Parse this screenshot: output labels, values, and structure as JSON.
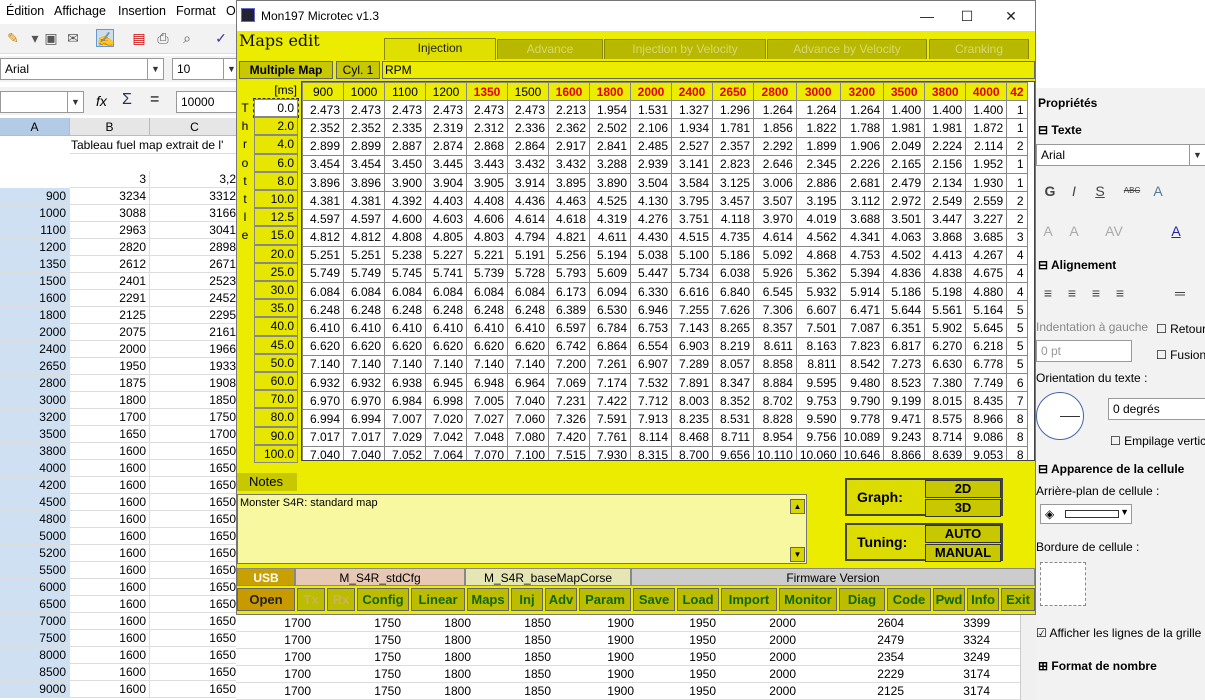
{
  "menubar": {
    "items": [
      "Édition",
      "Affichage",
      "Insertion",
      "Format",
      "O"
    ]
  },
  "font": {
    "name": "Arial",
    "size": "10"
  },
  "formula": {
    "value": "10000"
  },
  "sheet": {
    "columns": [
      "A",
      "B",
      "C"
    ],
    "row1": {
      "b": "Tableau fuel map extrait de l'"
    },
    "row3": {
      "b": "3",
      "c": "3,2"
    },
    "rows": [
      [
        "900",
        "3234",
        "3312"
      ],
      [
        "1000",
        "3088",
        "3166"
      ],
      [
        "1100",
        "2963",
        "3041"
      ],
      [
        "1200",
        "2820",
        "2898"
      ],
      [
        "1350",
        "2612",
        "2671"
      ],
      [
        "1500",
        "2401",
        "2523"
      ],
      [
        "1600",
        "2291",
        "2452"
      ],
      [
        "1800",
        "2125",
        "2295"
      ],
      [
        "2000",
        "2075",
        "2161"
      ],
      [
        "2400",
        "2000",
        "1966"
      ],
      [
        "2650",
        "1950",
        "1933"
      ],
      [
        "2800",
        "1875",
        "1908"
      ],
      [
        "3000",
        "1800",
        "1850"
      ],
      [
        "3200",
        "1700",
        "1750"
      ],
      [
        "3500",
        "1650",
        "1700"
      ],
      [
        "3800",
        "1600",
        "1650"
      ],
      [
        "4000",
        "1600",
        "1650"
      ],
      [
        "4200",
        "1600",
        "1650"
      ],
      [
        "4500",
        "1600",
        "1650"
      ],
      [
        "4800",
        "1600",
        "1650"
      ],
      [
        "5000",
        "1600",
        "1650"
      ],
      [
        "5200",
        "1600",
        "1650"
      ],
      [
        "5500",
        "1600",
        "1650"
      ],
      [
        "6000",
        "1600",
        "1650"
      ],
      [
        "6500",
        "1600",
        "1650"
      ],
      [
        "7000",
        "1600",
        "1650"
      ],
      [
        "7500",
        "1600",
        "1650"
      ],
      [
        "8000",
        "1600",
        "1650"
      ],
      [
        "8500",
        "1600",
        "1650"
      ],
      [
        "9000",
        "1600",
        "1650"
      ]
    ],
    "bottom_extra": [
      [
        "1700",
        "1750",
        "1800",
        "1850",
        "1900",
        "1950",
        "2000",
        "2604",
        "3399"
      ],
      [
        "1700",
        "1750",
        "1800",
        "1850",
        "1900",
        "1950",
        "2000",
        "2479",
        "3324"
      ],
      [
        "1700",
        "1750",
        "1800",
        "1850",
        "1900",
        "1950",
        "2000",
        "2354",
        "3249"
      ],
      [
        "1700",
        "1750",
        "1800",
        "1850",
        "1900",
        "1950",
        "2000",
        "2229",
        "3174"
      ],
      [
        "1700",
        "1750",
        "1800",
        "1850",
        "1900",
        "1950",
        "2000",
        "2125",
        "3174"
      ]
    ]
  },
  "props": {
    "title": "Propriétés",
    "texte": "Texte",
    "font": "Arial",
    "alignement": "Alignement",
    "indent": "Indentation à gauche",
    "indent_val": "0 pt",
    "retour": "Retour",
    "fusion": "Fusion",
    "orientation": "Orientation du texte :",
    "degrees": "0 degrés",
    "empilage": "Empilage vertic",
    "apparence": "Apparence de la cellule",
    "arriere": "Arrière-plan de cellule :",
    "bordure": "Bordure de cellule :",
    "grid_lines": "Afficher les lignes de la grille",
    "format": "Format de nombre"
  },
  "app": {
    "title": "Mon197 Microtec v1.3",
    "maps_edit": "Maps edit",
    "tabs": [
      "Injection",
      "Advance",
      "Injection by Velocity",
      "Advance by Velocity",
      "Cranking"
    ],
    "multiple_map": "Multiple Map",
    "cyl": "Cyl. 1",
    "rpm": "RPM",
    "ms": "[ms]",
    "throttle": [
      "T",
      "h",
      "r",
      "o",
      "t",
      "t",
      "l",
      "e"
    ],
    "rpm_cols": [
      "900",
      "1000",
      "1100",
      "1200",
      "1350",
      "1500",
      "1600",
      "1800",
      "2000",
      "2400",
      "2650",
      "2800",
      "3000",
      "3200",
      "3500",
      "3800",
      "4000",
      "42"
    ],
    "red_cols": [
      4,
      6,
      7,
      8,
      9,
      10,
      11,
      12,
      13,
      14,
      15,
      16,
      17
    ],
    "throttle_rows": [
      "0.0",
      "2.0",
      "4.0",
      "6.0",
      "8.0",
      "10.0",
      "12.5",
      "15.0",
      "20.0",
      "25.0",
      "30.0",
      "35.0",
      "40.0",
      "45.0",
      "50.0",
      "60.0",
      "70.0",
      "80.0",
      "90.0",
      "100.0"
    ],
    "table": [
      [
        "2.473",
        "2.473",
        "2.473",
        "2.473",
        "2.473",
        "2.473",
        "2.213",
        "1.954",
        "1.531",
        "1.327",
        "1.296",
        "1.264",
        "1.264",
        "1.264",
        "1.400",
        "1.400",
        "1.400",
        "1"
      ],
      [
        "2.352",
        "2.352",
        "2.335",
        "2.319",
        "2.312",
        "2.336",
        "2.362",
        "2.502",
        "2.106",
        "1.934",
        "1.781",
        "1.856",
        "1.822",
        "1.788",
        "1.981",
        "1.981",
        "1.872",
        "1"
      ],
      [
        "2.899",
        "2.899",
        "2.887",
        "2.874",
        "2.868",
        "2.864",
        "2.917",
        "2.841",
        "2.485",
        "2.527",
        "2.357",
        "2.292",
        "1.899",
        "1.906",
        "2.049",
        "2.224",
        "2.114",
        "2"
      ],
      [
        "3.454",
        "3.454",
        "3.450",
        "3.445",
        "3.443",
        "3.432",
        "3.432",
        "3.288",
        "2.939",
        "3.141",
        "2.823",
        "2.646",
        "2.345",
        "2.226",
        "2.165",
        "2.156",
        "1.952",
        "1"
      ],
      [
        "3.896",
        "3.896",
        "3.900",
        "3.904",
        "3.905",
        "3.914",
        "3.895",
        "3.890",
        "3.504",
        "3.584",
        "3.125",
        "3.006",
        "2.886",
        "2.681",
        "2.479",
        "2.134",
        "1.930",
        "1"
      ],
      [
        "4.381",
        "4.381",
        "4.392",
        "4.403",
        "4.408",
        "4.436",
        "4.463",
        "4.525",
        "4.130",
        "3.795",
        "3.457",
        "3.507",
        "3.195",
        "3.112",
        "2.972",
        "2.549",
        "2.559",
        "2"
      ],
      [
        "4.597",
        "4.597",
        "4.600",
        "4.603",
        "4.606",
        "4.614",
        "4.618",
        "4.319",
        "4.276",
        "3.751",
        "4.118",
        "3.970",
        "4.019",
        "3.688",
        "3.501",
        "3.447",
        "3.227",
        "2"
      ],
      [
        "4.812",
        "4.812",
        "4.808",
        "4.805",
        "4.803",
        "4.794",
        "4.821",
        "4.611",
        "4.430",
        "4.515",
        "4.735",
        "4.614",
        "4.562",
        "4.341",
        "4.063",
        "3.868",
        "3.685",
        "3"
      ],
      [
        "5.251",
        "5.251",
        "5.238",
        "5.227",
        "5.221",
        "5.191",
        "5.256",
        "5.194",
        "5.038",
        "5.100",
        "5.186",
        "5.092",
        "4.868",
        "4.753",
        "4.502",
        "4.413",
        "4.267",
        "4"
      ],
      [
        "5.749",
        "5.749",
        "5.745",
        "5.741",
        "5.739",
        "5.728",
        "5.793",
        "5.609",
        "5.447",
        "5.734",
        "6.038",
        "5.926",
        "5.362",
        "5.394",
        "4.836",
        "4.838",
        "4.675",
        "4"
      ],
      [
        "6.084",
        "6.084",
        "6.084",
        "6.084",
        "6.084",
        "6.084",
        "6.173",
        "6.094",
        "6.330",
        "6.616",
        "6.840",
        "6.545",
        "5.932",
        "5.914",
        "5.186",
        "5.198",
        "4.880",
        "4"
      ],
      [
        "6.248",
        "6.248",
        "6.248",
        "6.248",
        "6.248",
        "6.248",
        "6.389",
        "6.530",
        "6.946",
        "7.255",
        "7.626",
        "7.306",
        "6.607",
        "6.471",
        "5.644",
        "5.561",
        "5.164",
        "5"
      ],
      [
        "6.410",
        "6.410",
        "6.410",
        "6.410",
        "6.410",
        "6.410",
        "6.597",
        "6.784",
        "6.753",
        "7.143",
        "8.265",
        "8.357",
        "7.501",
        "7.087",
        "6.351",
        "5.902",
        "5.645",
        "5"
      ],
      [
        "6.620",
        "6.620",
        "6.620",
        "6.620",
        "6.620",
        "6.620",
        "6.742",
        "6.864",
        "6.554",
        "6.903",
        "8.219",
        "8.611",
        "8.163",
        "7.823",
        "6.817",
        "6.270",
        "6.218",
        "5"
      ],
      [
        "7.140",
        "7.140",
        "7.140",
        "7.140",
        "7.140",
        "7.140",
        "7.200",
        "7.261",
        "6.907",
        "7.289",
        "8.057",
        "8.858",
        "8.811",
        "8.542",
        "7.273",
        "6.630",
        "6.778",
        "5"
      ],
      [
        "6.932",
        "6.932",
        "6.938",
        "6.945",
        "6.948",
        "6.964",
        "7.069",
        "7.174",
        "7.532",
        "7.891",
        "8.347",
        "8.884",
        "9.595",
        "9.480",
        "8.523",
        "7.380",
        "7.749",
        "6"
      ],
      [
        "6.970",
        "6.970",
        "6.984",
        "6.998",
        "7.005",
        "7.040",
        "7.231",
        "7.422",
        "7.712",
        "8.003",
        "8.352",
        "8.702",
        "9.753",
        "9.790",
        "9.199",
        "8.015",
        "8.435",
        "7"
      ],
      [
        "6.994",
        "6.994",
        "7.007",
        "7.020",
        "7.027",
        "7.060",
        "7.326",
        "7.591",
        "7.913",
        "8.235",
        "8.531",
        "8.828",
        "9.590",
        "9.778",
        "9.471",
        "8.575",
        "8.966",
        "8"
      ],
      [
        "7.017",
        "7.017",
        "7.029",
        "7.042",
        "7.048",
        "7.080",
        "7.420",
        "7.761",
        "8.114",
        "8.468",
        "8.711",
        "8.954",
        "9.756",
        "10.089",
        "9.243",
        "8.714",
        "9.086",
        "8"
      ],
      [
        "7.040",
        "7.040",
        "7.052",
        "7.064",
        "7.070",
        "7.100",
        "7.515",
        "7.930",
        "8.315",
        "8.700",
        "9.656",
        "10.110",
        "10.060",
        "10.646",
        "8.866",
        "8.639",
        "9.053",
        "8"
      ]
    ],
    "notes_label": "Notes",
    "notes_text": "Monster S4R: standard map",
    "graph": "Graph:",
    "btn_2d": "2D",
    "btn_3d": "3D",
    "tuning": "Tuning:",
    "btn_auto": "AUTO",
    "btn_manual": "MANUAL",
    "usb": "USB",
    "cfg": "M_S4R_stdCfg",
    "basemap": "M_S4R_baseMapCorse",
    "firmware": "Firmware Version",
    "buttons": [
      "Open",
      "Tx",
      "Rx",
      "Config",
      "Linear",
      "Maps",
      "Inj",
      "Adv",
      "Param",
      "Save",
      "Load",
      "Import",
      "Monitor",
      "Diag",
      "Code",
      "Pwd",
      "Info",
      "Exit"
    ]
  }
}
